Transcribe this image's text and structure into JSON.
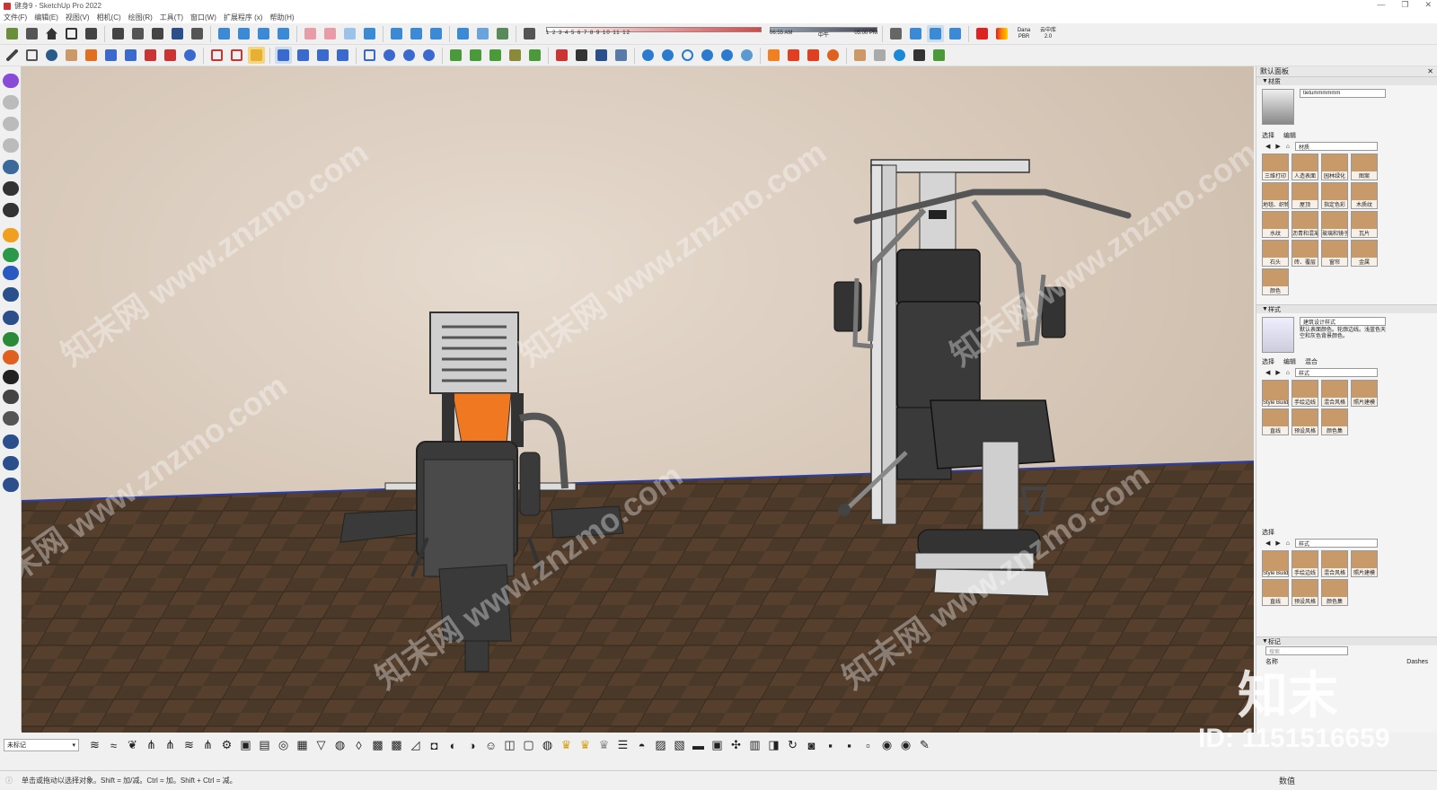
{
  "window": {
    "title": "健身9 - SketchUp Pro 2022",
    "controls": [
      "—",
      "❐",
      "✕"
    ]
  },
  "menu": [
    "文件(F)",
    "编辑(E)",
    "视图(V)",
    "相机(C)",
    "绘图(R)",
    "工具(T)",
    "窗口(W)",
    "扩展程序 (x)",
    "帮助(H)"
  ],
  "shadows": {
    "months": "1 2 3 4 5 6 7 8 9 10 11 12",
    "time_start": "06:55 AM",
    "time_mid": "中午",
    "time_end": "05:00 PM"
  },
  "enscape_label": "Dana PBR",
  "cloud_label": "云中库2.0",
  "viewport": {
    "watermark": "知末网 www.znzmo.com"
  },
  "tray": {
    "title": "默认面板",
    "materials": {
      "section": "材质",
      "name_value": "tietummmmmm",
      "tabs": [
        "选择",
        "编辑"
      ],
      "dropdown": "材质",
      "items": [
        "三维打印",
        "人造表面",
        "园林绿化",
        "图案",
        "地毯、织物",
        "屋顶",
        "指定色彩",
        "木质纹",
        "水纹",
        "沥青和混凝土",
        "玻璃和镜子",
        "瓦片",
        "石头",
        "砖、覆层",
        "窗帘",
        "金属",
        "颜色"
      ]
    },
    "styles": {
      "section": "样式",
      "name_value": "建筑设计样式",
      "description": "默认表面颜色。轮廓边线。浅蓝色天空和灰色背景颜色。",
      "tabs": [
        "选择",
        "编辑",
        "混合"
      ],
      "dropdown": "样式",
      "items": [
        "Style Builder",
        "手绘边线",
        "混合风格",
        "照片建模",
        "直线",
        "预设风格",
        "颜色集"
      ]
    },
    "styles2": {
      "tab": "选择",
      "dropdown": "样式",
      "items": [
        "Style Builder",
        "手绘边线",
        "混合风格",
        "照片建模",
        "直线",
        "预设风格",
        "颜色集"
      ]
    },
    "tags": {
      "section": "标记",
      "search_placeholder": "搜索",
      "col_name": "名称",
      "col_dashes": "Dashes"
    }
  },
  "bottom": {
    "tag_value": "未标记"
  },
  "status": {
    "hint": "单击或拖动以选择对象。Shift = 加/减。Ctrl = 加。Shift + Ctrl = 减。",
    "value_label": "数值"
  },
  "overlay": {
    "brand": "知末",
    "id": "ID: 1151516659"
  },
  "colors": {
    "wall": "#ddd0c2",
    "floor": "#4a3828",
    "horizon": "#2b3ea8",
    "machine_dark": "#3a3a3a",
    "machine_light": "#d9d9d9",
    "accent_orange": "#f07820"
  }
}
